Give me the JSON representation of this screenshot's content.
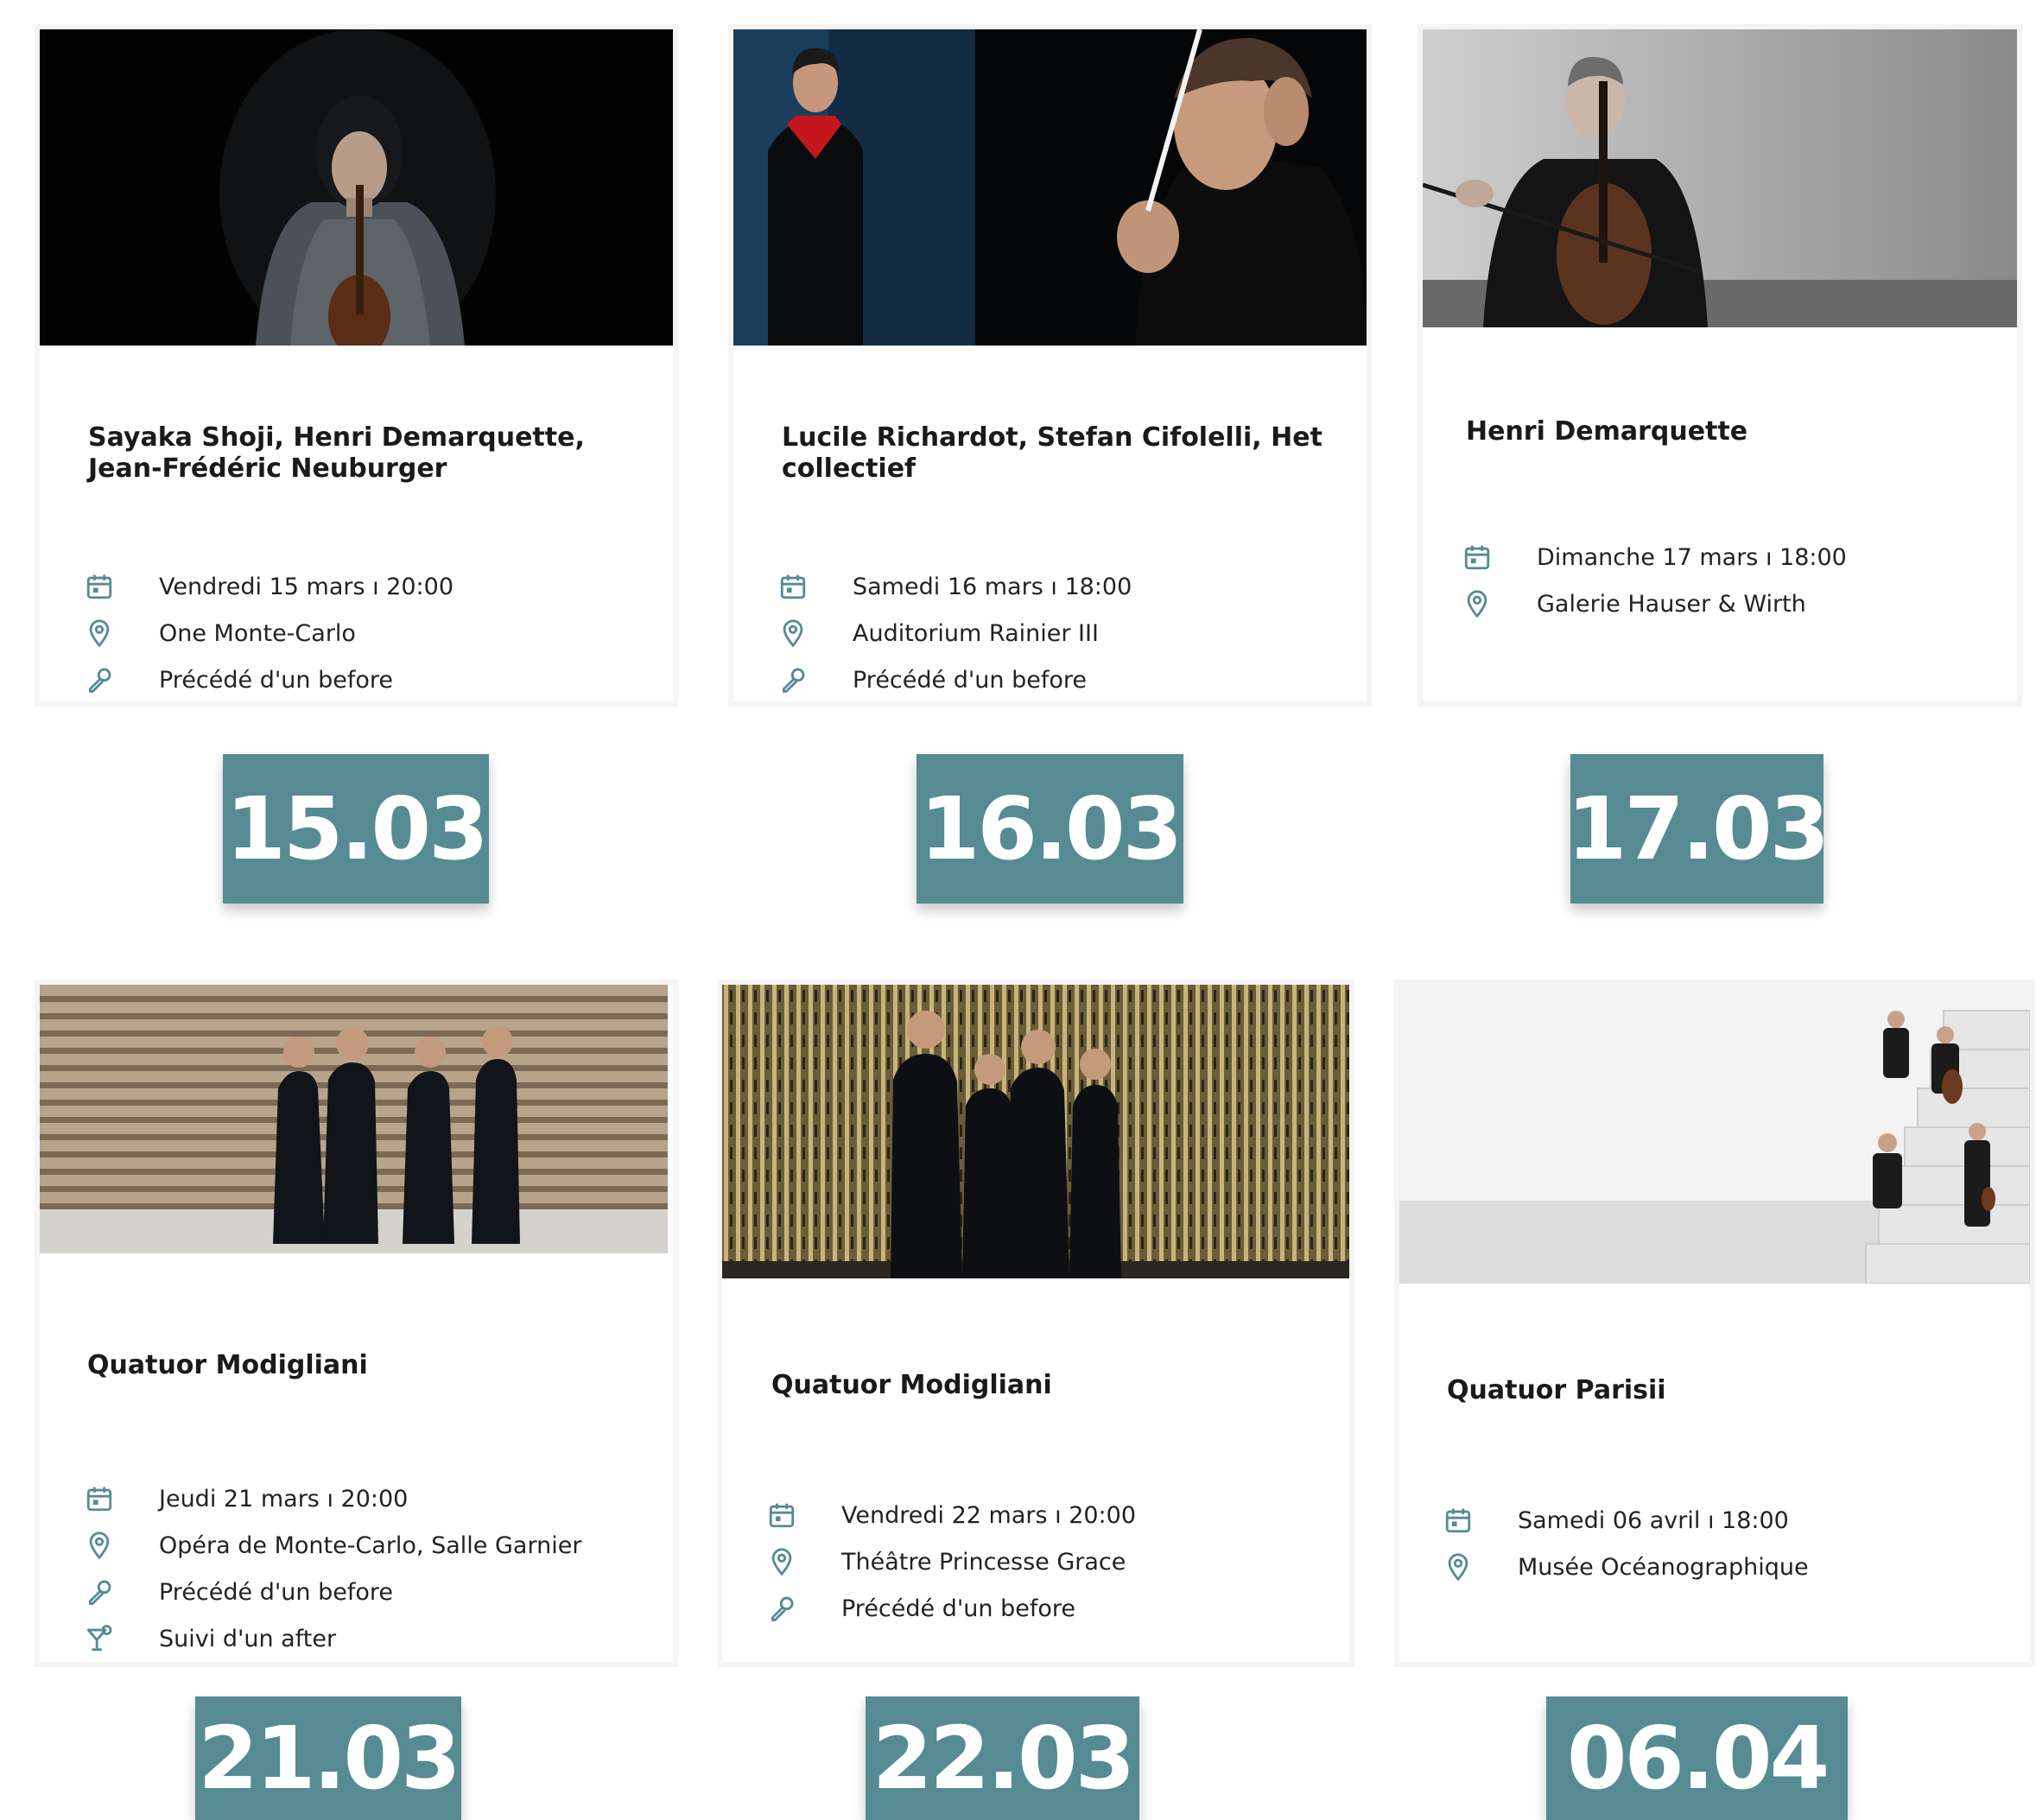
{
  "accent_color": "#568b93",
  "events": [
    {
      "title": "Sayaka Shoji, Henri Demarquette, Jean-Frédéric Neuburger",
      "date": "Vendredi 15 mars ı 20:00",
      "venue": "One Monte-Carlo",
      "extras": [
        "Précédé d'un before"
      ],
      "badge": "15.03"
    },
    {
      "title": "Lucile Richardot, Stefan Cifolelli, Het collectief",
      "date": "Samedi 16 mars ı 18:00",
      "venue": "Auditorium Rainier III",
      "extras": [
        "Précédé d'un before"
      ],
      "badge": "16.03"
    },
    {
      "title": "Henri Demarquette",
      "date": "Dimanche 17 mars ı 18:00",
      "venue": "Galerie Hauser & Wirth",
      "extras": [],
      "badge": "17.03"
    },
    {
      "title": "Quatuor Modigliani",
      "date": "Jeudi 21 mars ı 20:00",
      "venue": "Opéra de Monte-Carlo, Salle Garnier",
      "extras": [
        "Précédé d'un before",
        "Suivi d'un after"
      ],
      "badge": "21.03"
    },
    {
      "title": "Quatuor Modigliani",
      "date": "Vendredi 22 mars ı 20:00",
      "venue": "Théâtre Princesse Grace",
      "extras": [
        "Précédé d'un before"
      ],
      "badge": "22.03"
    },
    {
      "title": "Quatuor Parisii",
      "date": "Samedi 06 avril ı 18:00",
      "venue": "Musée Océanographique",
      "extras": [],
      "badge": "06.04"
    }
  ]
}
